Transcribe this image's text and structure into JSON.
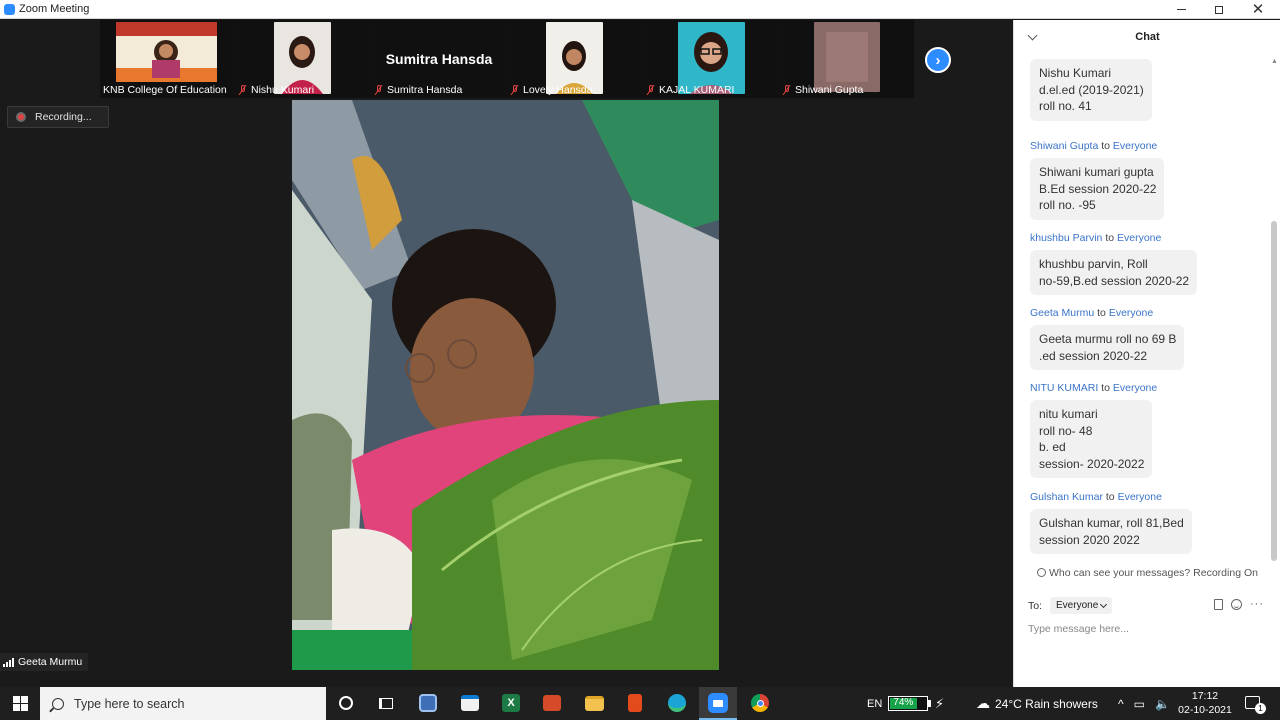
{
  "window": {
    "title": "Zoom Meeting"
  },
  "participants": [
    {
      "name": "KNB College Of Education",
      "muted": false,
      "video": "banner"
    },
    {
      "name": "Nishu Kumari",
      "muted": true,
      "video": "person"
    },
    {
      "name": "Sumitra Hansda",
      "muted": true,
      "video": "off",
      "display_name": "Sumitra Hansda"
    },
    {
      "name": "Lovely Hansda",
      "muted": true,
      "video": "person"
    },
    {
      "name": "KAJAL KUMARI",
      "muted": true,
      "video": "person"
    },
    {
      "name": "Shiwani Gupta",
      "muted": true,
      "video": "blurred"
    }
  ],
  "recording": {
    "label": "Recording..."
  },
  "active_speaker": {
    "name": "Geeta Murmu"
  },
  "chat": {
    "title": "Chat",
    "messages": [
      {
        "from": "",
        "to": "",
        "text": "Nishu Kumari\nd.el.ed (2019-2021)\nroll no. 41"
      },
      {
        "from": "Shiwani Gupta",
        "to": "Everyone",
        "text": "Shiwani kumari gupta\nB.Ed session 2020-22\nroll no. -95"
      },
      {
        "from": "khushbu Parvin",
        "to": "Everyone",
        "text": "khushbu parvin, Roll\nno-59,B.ed session 2020-22"
      },
      {
        "from": "Geeta Murmu",
        "to": "Everyone",
        "text": "Geeta  murmu  roll no  69 B\n.ed  session  2020-22"
      },
      {
        "from": "NITU KUMARI",
        "to": "Everyone",
        "text": "nitu kumari\nroll no- 48\nb. ed\nsession- 2020-2022"
      },
      {
        "from": "Gulshan Kumar",
        "to": "Everyone",
        "text": "Gulshan kumar, roll 81,Bed\nsession 2020 2022"
      }
    ],
    "to_word": "to",
    "visibility_notice": "Who can see your messages? Recording On",
    "to_label": "To:",
    "to_value": "Everyone",
    "input_placeholder": "Type message here..."
  },
  "taskbar": {
    "search_placeholder": "Type here to search",
    "apps": [
      "cortana",
      "task-view",
      "vpn-app",
      "store",
      "excel",
      "presentation",
      "file-explorer",
      "office",
      "edge",
      "zoom",
      "chrome"
    ],
    "language": "EN",
    "battery": "74%",
    "battery_level": 0.74,
    "weather": "24°C  Rain showers",
    "time": "17:12",
    "date": "02-10-2021",
    "notification_count": "1"
  },
  "colors": {
    "zoom_blue": "#2d8cff",
    "muted_red": "#e04343",
    "chat_name": "#3a74c8",
    "battery_green": "#17a34a"
  }
}
